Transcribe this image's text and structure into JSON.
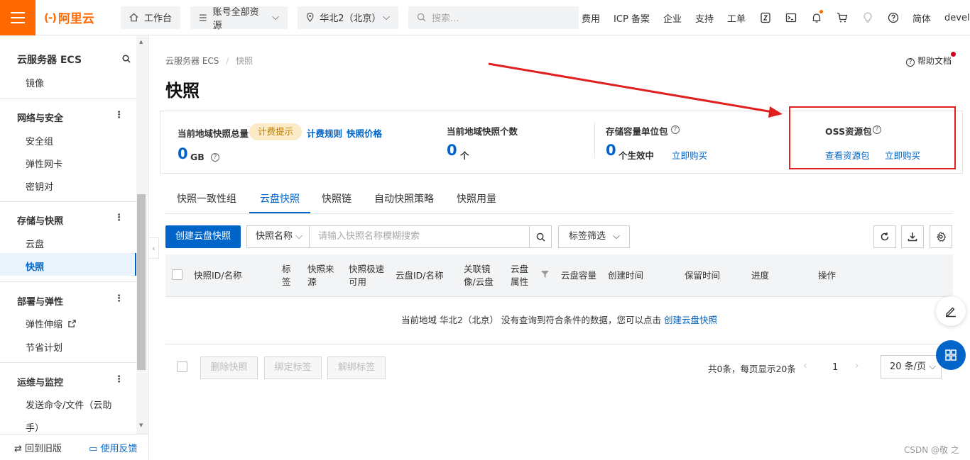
{
  "topbar": {
    "logo_mark": "(-)",
    "logo_text": "阿里云",
    "workbench": "工作台",
    "resources": "账号全部资源",
    "region": "华北2（北京）",
    "search_placeholder": "搜索...",
    "links": [
      "费用",
      "ICP 备案",
      "企业",
      "支持",
      "工单"
    ],
    "lang": "简体",
    "user": "devel"
  },
  "sidebar": {
    "title": "云服务器 ECS",
    "top_item": "镜像",
    "groups": [
      {
        "label": "网络与安全",
        "items": [
          "安全组",
          "弹性网卡",
          "密钥对"
        ]
      },
      {
        "label": "存储与快照",
        "items": [
          "云盘",
          "快照"
        ]
      },
      {
        "label": "部署与弹性",
        "items": [
          "弹性伸缩",
          "节省计划"
        ]
      },
      {
        "label": "运维与监控",
        "items": [
          "发送命令/文件（云助",
          "手）"
        ]
      }
    ],
    "bottom_left": "回到旧版",
    "bottom_right": "使用反馈"
  },
  "main": {
    "breadcrumb": [
      "云服务器 ECS",
      "快照"
    ],
    "help": "帮助文档",
    "title": "快照",
    "stats": {
      "total_label": "当前地域快照总量",
      "billing_tag": "计费提示",
      "rule_link": "计费规则",
      "price_link": "快照价格",
      "total_value": "0",
      "total_unit": "GB",
      "count_label": "当前地域快照个数",
      "count_value": "0",
      "count_unit": "个",
      "pkg_label": "存储容量单位包",
      "pkg_value": "0",
      "pkg_unit": "个生效中",
      "pkg_buy": "立即购买",
      "oss_label": "OSS资源包",
      "oss_view": "查看资源包",
      "oss_buy": "立即购买"
    },
    "tabs": [
      "快照一致性组",
      "云盘快照",
      "快照链",
      "自动快照策略",
      "快照用量"
    ],
    "create_button": "创建云盘快照",
    "search_field": "快照名称",
    "search_placeholder": "请输入快照名称模糊搜索",
    "tag_filter": "标签筛选",
    "columns": {
      "id": "快照ID/名称",
      "tag": [
        "标",
        "签"
      ],
      "source": [
        "快照来",
        "源"
      ],
      "fast": [
        "快照极速",
        "可用"
      ],
      "disk": "云盘ID/名称",
      "image": [
        "关联镜",
        "像/云盘"
      ],
      "attr": [
        "云盘",
        "属性"
      ],
      "capacity": "云盘容量",
      "created": "创建时间",
      "retention": "保留时间",
      "progress": "进度",
      "ops": "操作"
    },
    "empty_text": "当前地域 华北2（北京） 没有查询到符合条件的数据，您可以点击",
    "empty_link": "创建云盘快照",
    "bulk": [
      "删除快照",
      "绑定标签",
      "解绑标签"
    ],
    "pager_text": "共0条，每页显示20条",
    "page": "1",
    "page_size": "20 条/页"
  },
  "watermark": "CSDN @敬 之",
  "colors": {
    "brand": "#ff6a00",
    "accent": "#0064c8",
    "annotation": "#e02020"
  }
}
